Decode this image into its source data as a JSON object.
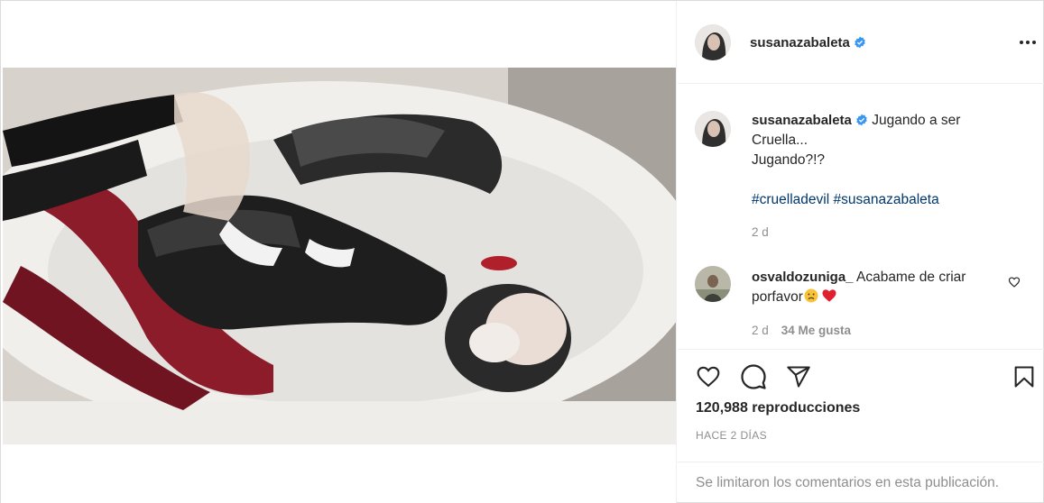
{
  "post": {
    "author": "susanazabaleta",
    "verified": true,
    "caption": {
      "username": "susanazabaleta",
      "line1": "Jugando a ser",
      "line2": "Cruella...",
      "line3": "Jugando?!?",
      "hashtags": [
        "#cruelladevil",
        "#susanazabaleta"
      ],
      "time": "2 d"
    },
    "comments": [
      {
        "username": "osvaldozuniga_",
        "text_line1": "Acabame de criar",
        "text_line2": "porfavor",
        "emojis": [
          "sad-face",
          "red-heart"
        ],
        "time": "2 d",
        "likes": "34 Me gusta"
      }
    ],
    "views": "120,988 reproducciones",
    "posted_ago": "HACE 2 DÍAS",
    "comments_disabled": "Se limitaron los comentarios en esta publicación."
  },
  "icons": {
    "more": "more-dots-icon",
    "like": "heart-outline-icon",
    "comment": "comment-bubble-icon",
    "share": "paper-plane-icon",
    "save": "bookmark-icon",
    "mute": "muted-speaker-icon",
    "verified": "verified-badge-icon"
  },
  "colors": {
    "verified": "#3897f0",
    "hashtag": "#00376b",
    "muted_text": "#8e8e8e",
    "border": "#efefef"
  }
}
